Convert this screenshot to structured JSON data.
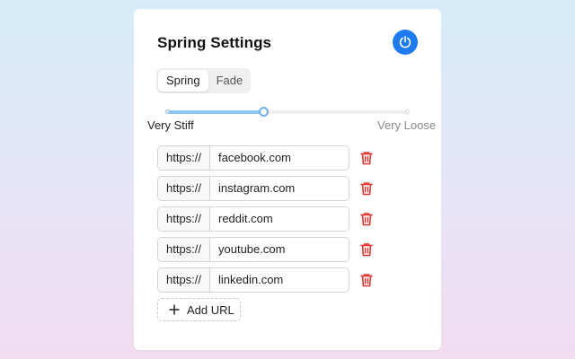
{
  "title": "Spring Settings",
  "power_icon": "power-icon",
  "colors": {
    "accent": "#1f7bf2",
    "slider_fill": "#8cc4f5",
    "delete": "#e5322d"
  },
  "tabs": [
    {
      "label": "Spring",
      "active": true
    },
    {
      "label": "Fade",
      "active": false
    }
  ],
  "slider": {
    "value_fraction": 0.4,
    "min_label": "Very Stiff",
    "max_label": "Very Loose"
  },
  "urls": [
    {
      "prefix": "https://",
      "value": "facebook.com"
    },
    {
      "prefix": "https://",
      "value": "instagram.com"
    },
    {
      "prefix": "https://",
      "value": "reddit.com"
    },
    {
      "prefix": "https://",
      "value": "youtube.com"
    },
    {
      "prefix": "https://",
      "value": "linkedin.com"
    }
  ],
  "delete_icon": "trash-icon",
  "add_url": {
    "label": "Add URL",
    "icon": "plus-icon"
  }
}
